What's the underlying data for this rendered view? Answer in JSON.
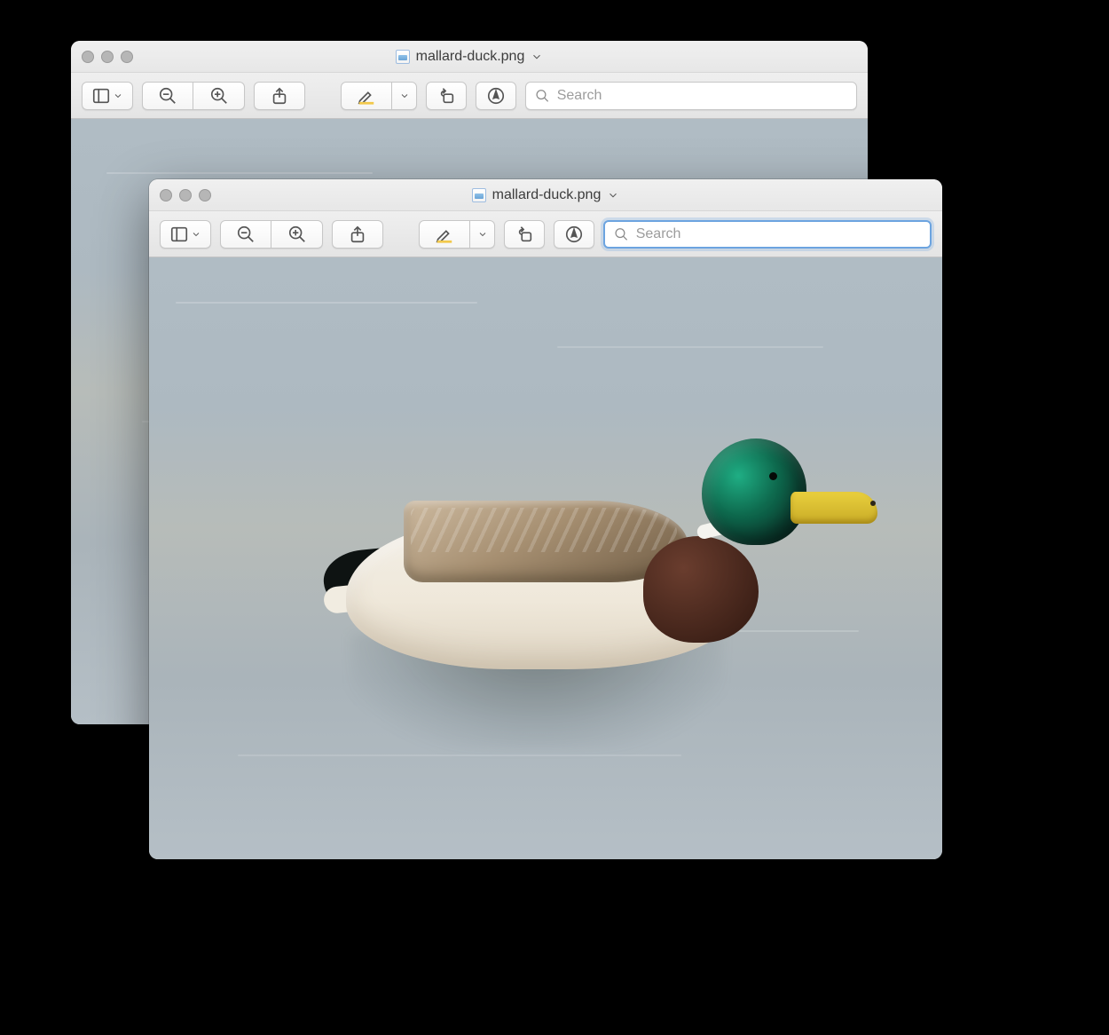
{
  "windows": [
    {
      "role": "back",
      "title": "mallard-duck.png",
      "toolbar": {
        "sidebar_label": "View Sidebar",
        "zoom_out_label": "Zoom Out",
        "zoom_in_label": "Zoom In",
        "share_label": "Share",
        "markup_label": "Markup",
        "markup_menu_label": "Markup Options",
        "rotate_label": "Rotate Left",
        "annotate_label": "Annotate",
        "search_placeholder": "Search",
        "search_value": ""
      }
    },
    {
      "role": "front",
      "title": "mallard-duck.png",
      "toolbar": {
        "sidebar_label": "View Sidebar",
        "zoom_out_label": "Zoom Out",
        "zoom_in_label": "Zoom In",
        "share_label": "Share",
        "markup_label": "Markup",
        "markup_menu_label": "Markup Options",
        "rotate_label": "Rotate Left",
        "annotate_label": "Annotate",
        "search_placeholder": "Search",
        "search_value": ""
      }
    }
  ],
  "image_content_description": "Photograph of a male mallard duck swimming on calm water with reflection"
}
